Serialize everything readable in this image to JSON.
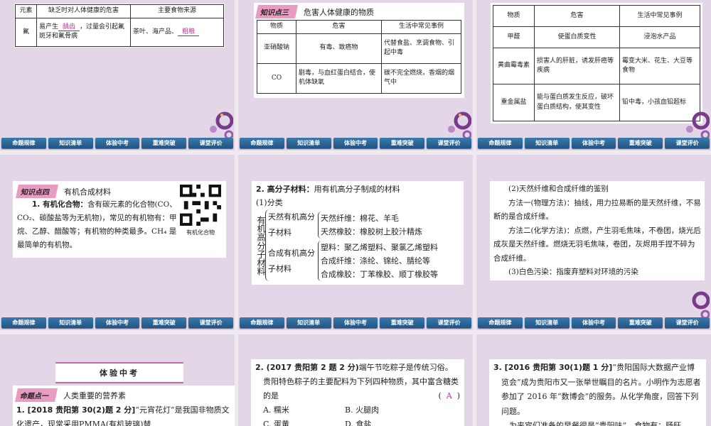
{
  "nav": [
    "命题规律",
    "知识清单",
    "体验中考",
    "重难突破",
    "课堂评价"
  ],
  "slide1": {
    "headers": [
      "元素",
      "缺乏时对人体健康的危害",
      "主要食物来源"
    ],
    "element": "氟",
    "harm_pre": "易产生",
    "harm_ans": "龋齿",
    "harm_post": "，过量会引起氟斑牙和氟骨病",
    "source_pre": "茶叶、海产品、",
    "source_ans": "粗粮"
  },
  "slide2": {
    "badge": "知识点三",
    "title": "危害人体健康的物质",
    "headers": [
      "物质",
      "危害",
      "生活中常见事例"
    ],
    "rows": [
      [
        "亚硝酸钠",
        "有毒、致癌物",
        "代替食盐、烹调食物、引起中毒"
      ],
      [
        "CO",
        "剧毒，与血红蛋白结合，使机体缺氧",
        "碳不完全燃烧，香烟的烟气中"
      ]
    ]
  },
  "slide3": {
    "headers": [
      "物质",
      "危害",
      "生活中常见事例"
    ],
    "rows": [
      [
        "甲醛",
        "使蛋白质变性",
        "浸泡水产品"
      ],
      [
        "黄曲霉毒素",
        "损害人的肝脏，诱发肝癌等疾病",
        "霉变大米、花生、大豆等食物"
      ],
      [
        "重金属盐",
        "能与蛋白质发生反应，破坏蛋白质结构，使其变性",
        "铅中毒，小孩血铅超标"
      ]
    ]
  },
  "slide4": {
    "badge": "知识点四",
    "title": "有机合成材料",
    "lead": "1. 有机化合物：",
    "text": "含有碳元素的化合物(CO、CO₂、碳酸盐等为无机物)，常见的有机物有：甲烷、乙醇、醋酸等；有机物的种类最多。CH₄ 是最简单的有机物。",
    "qr_caption": "有机化合物"
  },
  "slide5": {
    "lead": "2. 高分子材料：",
    "heading": "用有机高分子制成的材料",
    "sub": "(1)分类",
    "root": "有机高分子材料",
    "groups": [
      {
        "name": "天然有机高分子材料",
        "items": [
          "天然纤维：棉花、羊毛",
          "天然橡胶：橡胶树上胶汁精炼"
        ]
      },
      {
        "name": "合成有机高分子材料",
        "items": [
          "塑料：聚乙烯塑料、聚氯乙烯塑料",
          "合成纤维：涤纶、锦纶、腈纶等",
          "合成橡胶：丁苯橡胶、顺丁橡胶等"
        ]
      }
    ]
  },
  "slide6": {
    "lines": [
      "(2)天然纤维和合成纤维的鉴别",
      "方法一(物理方法)：抽线，用力拉易断的是天然纤维，不易断的是合成纤维。",
      "方法二(化学方法)：点燃，产生羽毛焦味，不卷团，烧光后成灰是天然纤维。燃烧无羽毛焦味，卷团，灰烬用手捏不碎为合成纤维。",
      "(3)白色污染：指废弃塑料对环境的污染"
    ]
  },
  "slide7": {
    "banner": "体验中考",
    "badge": "命题点一",
    "title": "人类重要的营养素",
    "q_src": "1. [2018 贵阳第 30(2)题 2 分]",
    "q_text": "“元宵花灯”是我国非物质文化遗产，现常采用PMMA(有机玻璃)替"
  },
  "slide8": {
    "q_src": "2. (2017 贵阳第 2 题 2 分)",
    "q_text": "端午节吃粽子是传统习俗。贵阳特色粽子的主要配料为下列四种物质，其中富含糖类的是",
    "answer": "A",
    "options": [
      "A. 糯米",
      "B. 火腿肉",
      "C. 蛋黄",
      "D. 食盐"
    ]
  },
  "slide9": {
    "q_src": "3. [2016 贵阳第 30(1)题 1 分]",
    "q_text": "“贵阳国际大数据产业博览会”成为贵阳市又一张举世瞩目的名片。小明作为志愿者参加了 2016 年“数博会”的服务。从化学角度，回答下列问题。",
    "q_next": "为来宾们准备的早餐很是“贵阳味”，食物有：肠旺"
  },
  "colors": {
    "background": "#e3d6e7",
    "nav": "#2b6a9a",
    "answer": "#c0399a",
    "badge": "#e99bc1"
  }
}
